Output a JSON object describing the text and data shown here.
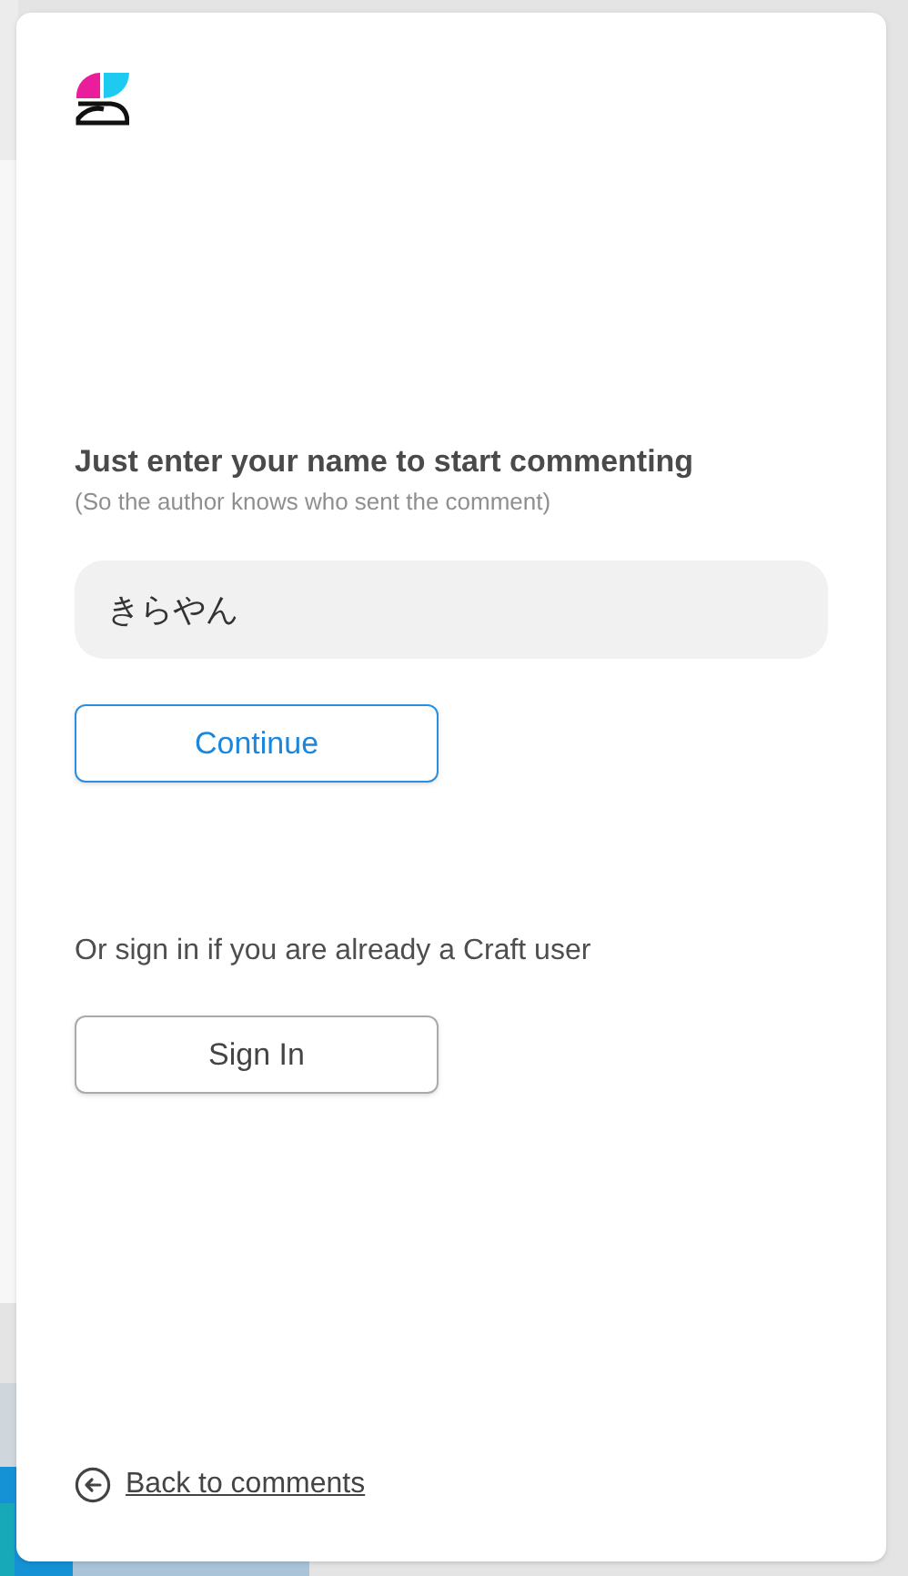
{
  "dialog": {
    "title": "Just enter your name to start commenting",
    "subtitle": "(So the author knows who sent the comment)",
    "name_field": {
      "value": "きらやん"
    },
    "continue_button": "Continue",
    "sign_in_prompt": "Or sign in if you are already a Craft user",
    "sign_in_button": "Sign In",
    "back_link": "Back to comments"
  }
}
